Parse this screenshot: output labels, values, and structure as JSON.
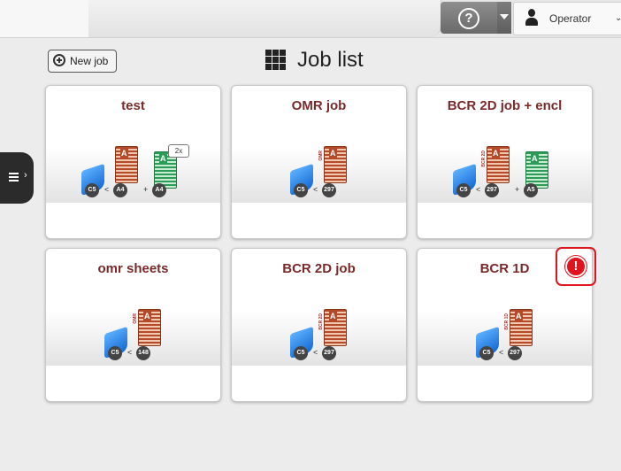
{
  "topbar": {
    "user_name": "Operator",
    "help_icon": "help-icon",
    "user_icon": "person-icon"
  },
  "toolbar": {
    "new_job_label": "New job",
    "page_title": "Job list"
  },
  "jobs": [
    {
      "name": "test",
      "envelope": "C5",
      "documents": [
        {
          "label": "A4",
          "color": "red",
          "operator": "<"
        },
        {
          "label": "A4",
          "color": "green",
          "operator": "+",
          "multiplier": "2x"
        }
      ]
    },
    {
      "name": "OMR job",
      "envelope": "C5",
      "documents": [
        {
          "label": "297",
          "color": "red",
          "operator": "<",
          "side_label": "OMR"
        }
      ]
    },
    {
      "name": "BCR 2D job + encl",
      "envelope": "C5",
      "documents": [
        {
          "label": "297",
          "color": "red",
          "operator": "<",
          "side_label": "BCR 2D"
        },
        {
          "label": "A5",
          "color": "green",
          "operator": "+"
        }
      ]
    },
    {
      "name": "omr sheets",
      "envelope": "C5",
      "documents": [
        {
          "label": "148",
          "color": "red",
          "operator": "<",
          "side_label": "OMR"
        }
      ]
    },
    {
      "name": "BCR 2D job",
      "envelope": "C5",
      "documents": [
        {
          "label": "297",
          "color": "red",
          "operator": "<",
          "side_label": "BCR 2D"
        }
      ]
    },
    {
      "name": "BCR 1D",
      "envelope": "C5",
      "warning": "!",
      "documents": [
        {
          "label": "297",
          "color": "red",
          "operator": "<",
          "side_label": "BCR 1D"
        }
      ]
    }
  ],
  "doc_letter": "A",
  "colors": {
    "title": "#7a2a2a",
    "warning": "#e0141c",
    "envelope": "#2d86e6",
    "main_doc": "#b34a2a",
    "insert_doc": "#2e9b58"
  }
}
